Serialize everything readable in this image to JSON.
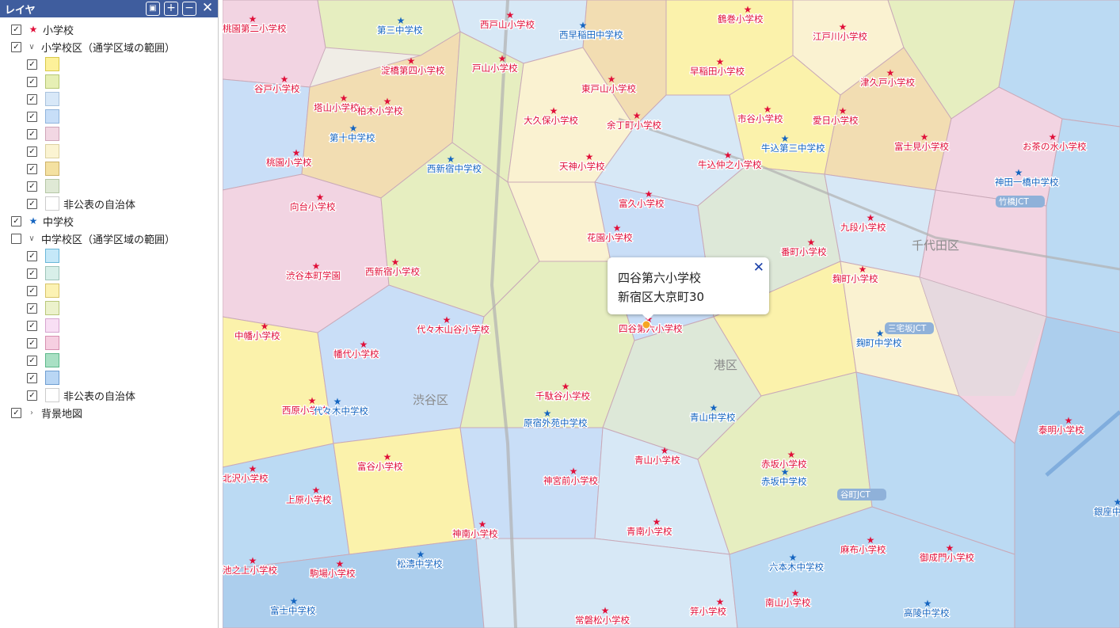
{
  "panel": {
    "title": "レイヤ",
    "buttons": [
      "folder-add-icon",
      "expand-all-icon",
      "collapse-all-icon",
      "close-icon"
    ],
    "layers": [
      {
        "label": "小学校",
        "checked": true,
        "symbol": "star-icon",
        "symbol_color": "#e0103a"
      },
      {
        "label": "小学校区（通学区域の範囲）",
        "checked": true,
        "expanded": true,
        "swatches": [
          "#fdf19a",
          "#e6efb4",
          "#d8e8f8",
          "#c7def8",
          "#f2d7e3",
          "#fbf4d2",
          "#f4e1a1",
          "#dfe9d5"
        ],
        "swatch_borders": [
          "#d8c94a",
          "#b6c774",
          "#a9c2de",
          "#90b4dc",
          "#cfa5b9",
          "#dcd1a0",
          "#cdb26a",
          "#b5c6a6"
        ],
        "nonpublic_label": "非公表の自治体"
      },
      {
        "label": "中学校",
        "checked": true,
        "symbol": "star-icon",
        "symbol_color": "#1565c0"
      },
      {
        "label": "中学校区（通学区域の範囲）",
        "checked": false,
        "expanded": true,
        "swatches": [
          "#c5e8f8",
          "#d8efe9",
          "#fcf2b3",
          "#ecf2cc",
          "#f8dff4",
          "#f6cfe1",
          "#a9e0c4",
          "#b9d6f4"
        ],
        "swatch_borders": [
          "#6ab7d8",
          "#9dc4b9",
          "#d8c46a",
          "#b9c77a",
          "#d6a5cf",
          "#d68fb0",
          "#5cb88a",
          "#6f9ed1"
        ],
        "nonpublic_label": "非公表の自治体"
      },
      {
        "label": "背景地図",
        "checked": true,
        "expanded": false
      }
    ]
  },
  "popup": {
    "name": "四谷第六小学校",
    "address": "新宿区大京町30",
    "close_icon": "close-icon"
  },
  "map": {
    "district_colors": [
      "#fcf3a8",
      "#e6efbf",
      "#d6e8f7",
      "#c7def8",
      "#f3d3e2",
      "#fbf3d0",
      "#f3ddb0",
      "#dce8d8",
      "#b9d9f4",
      "#a9cdee"
    ],
    "elementary_schools": [
      "桃園第二小学校",
      "西戸山小学校",
      "鶴巻小学校",
      "江戸川小学校",
      "淀橋第四小学校",
      "戸山小学校",
      "早稲田小学校",
      "谷戸小学校",
      "東戸山小学校",
      "津久戸小学校",
      "塔山小学校",
      "柏木小学校",
      "大久保小学校",
      "余丁町小学校",
      "市谷小学校",
      "愛日小学校",
      "富士見小学校",
      "お茶の水小学校",
      "桃園小学校",
      "天神小学校",
      "牛込仲之小学校",
      "向台小学校",
      "富久小学校",
      "九段小学校",
      "花園小学校",
      "番町小学校",
      "渋谷本町学園",
      "西新宿小学校",
      "麹町小学校",
      "四谷第六小学校",
      "中幡小学校",
      "代々木山谷小学校",
      "幡代小学校",
      "千駄谷小学校",
      "西原小学校",
      "富谷小学校",
      "青山小学校",
      "赤坂小学校",
      "泰明小学校",
      "北沢小学校",
      "上原小学校",
      "神宮前小学校",
      "神南小学校",
      "青南小学校",
      "麻布小学校",
      "御成門小学校",
      "池之上小学校",
      "駒場小学校",
      "南山小学校",
      "笄小学校",
      "常磐松小学校"
    ],
    "junior_high_schools": [
      "第三中学校",
      "西早稲田中学校",
      "牛込第三中学校",
      "第十中学校",
      "西新宿中学校",
      "神田一橋中学校",
      "麹町中学校",
      "青山中学校",
      "原宿外苑中学校",
      "代々木中学校",
      "赤坂中学校",
      "松濤中学校",
      "六本木中学校",
      "富士中学校",
      "高陵中学校",
      "銀座中学校"
    ],
    "areas": [
      "千代田区",
      "港区",
      "渋谷区"
    ],
    "highways": [
      "竹橋JCT",
      "三宅坂JCT",
      "谷町JCT"
    ]
  }
}
